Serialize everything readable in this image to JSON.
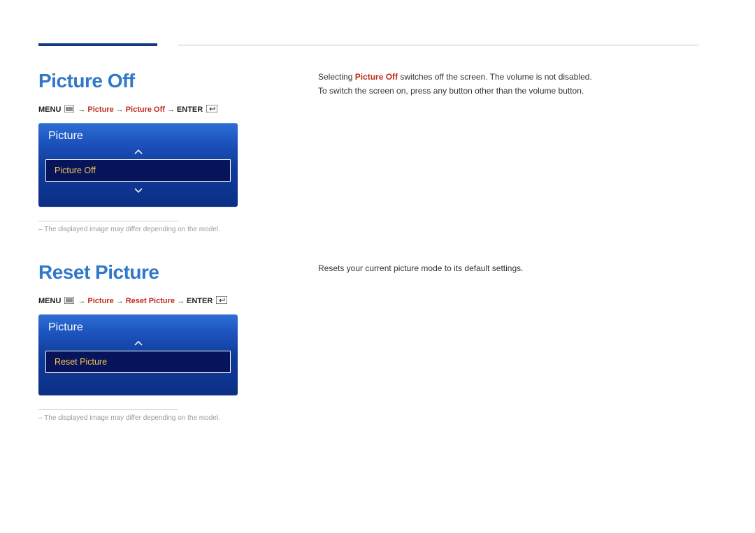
{
  "section1": {
    "title": "Picture Off",
    "nav": {
      "menu": "MENU",
      "seg1": "Picture",
      "seg2": "Picture Off",
      "enter": "ENTER",
      "arrow": "→"
    },
    "osd": {
      "title": "Picture",
      "item": "Picture Off"
    },
    "footnote": "The displayed image may differ depending on the model.",
    "desc": {
      "p1a": "Selecting ",
      "p1b": "Picture Off",
      "p1c": " switches off the screen. The volume is not disabled.",
      "p2": "To switch the screen on, press any button other than the volume button."
    }
  },
  "section2": {
    "title": "Reset Picture",
    "nav": {
      "menu": "MENU",
      "seg1": "Picture",
      "seg2": "Reset Picture",
      "enter": "ENTER",
      "arrow": "→"
    },
    "osd": {
      "title": "Picture",
      "item": "Reset Picture"
    },
    "footnote": "The displayed image may differ depending on the model.",
    "desc": {
      "p1": "Resets your current picture mode to its default settings."
    }
  }
}
